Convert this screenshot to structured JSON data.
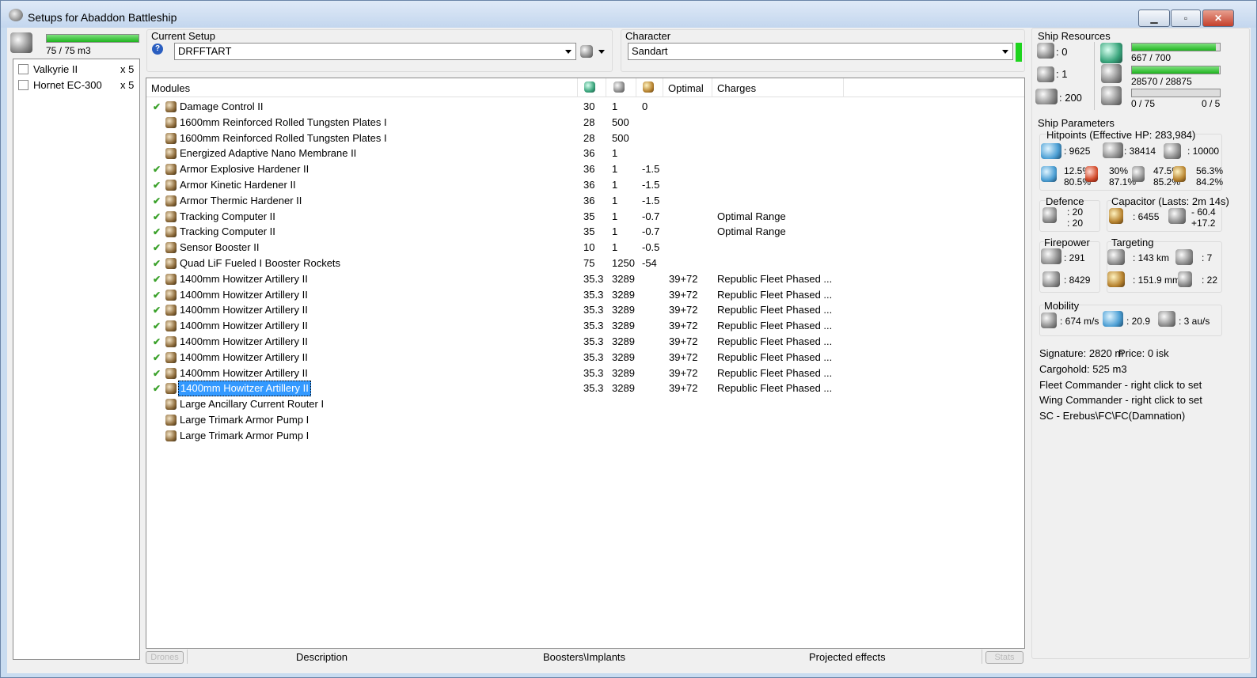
{
  "window": {
    "title": "Setups for Abaddon Battleship",
    "minimize": "▁",
    "maximize": "▫",
    "close": "✕"
  },
  "drones": {
    "bay_text": "75 / 75 m3",
    "bay_fill": 1.0,
    "items": [
      {
        "name": "Valkyrie II",
        "qty": "x 5"
      },
      {
        "name": "Hornet EC-300",
        "qty": "x 5"
      }
    ]
  },
  "setup": {
    "label": "Current Setup",
    "value": "DRFFTART",
    "help": "?"
  },
  "character": {
    "label": "Character",
    "value": "Sandart"
  },
  "modules": {
    "headers": {
      "name": "Modules",
      "optimal": "Optimal",
      "charges": "Charges"
    },
    "rows": [
      {
        "check": "✔",
        "name": "Damage Control II",
        "cpu": "30",
        "pg": "1",
        "cap": "0",
        "optimal": "",
        "charges": ""
      },
      {
        "check": "",
        "name": "1600mm Reinforced Rolled Tungsten Plates I",
        "cpu": "28",
        "pg": "500",
        "cap": "",
        "optimal": "",
        "charges": ""
      },
      {
        "check": "",
        "name": "1600mm Reinforced Rolled Tungsten Plates I",
        "cpu": "28",
        "pg": "500",
        "cap": "",
        "optimal": "",
        "charges": ""
      },
      {
        "check": "",
        "name": "Energized Adaptive Nano Membrane II",
        "cpu": "36",
        "pg": "1",
        "cap": "",
        "optimal": "",
        "charges": ""
      },
      {
        "check": "✔",
        "name": "Armor Explosive Hardener II",
        "cpu": "36",
        "pg": "1",
        "cap": "-1.5",
        "optimal": "",
        "charges": ""
      },
      {
        "check": "✔",
        "name": "Armor Kinetic Hardener II",
        "cpu": "36",
        "pg": "1",
        "cap": "-1.5",
        "optimal": "",
        "charges": ""
      },
      {
        "check": "✔",
        "name": "Armor Thermic Hardener II",
        "cpu": "36",
        "pg": "1",
        "cap": "-1.5",
        "optimal": "",
        "charges": ""
      },
      {
        "check": "✔",
        "name": "Tracking Computer II",
        "cpu": "35",
        "pg": "1",
        "cap": "-0.7",
        "optimal": "",
        "charges": "Optimal Range"
      },
      {
        "check": "✔",
        "name": "Tracking Computer II",
        "cpu": "35",
        "pg": "1",
        "cap": "-0.7",
        "optimal": "",
        "charges": "Optimal Range"
      },
      {
        "check": "✔",
        "name": "Sensor Booster II",
        "cpu": "10",
        "pg": "1",
        "cap": "-0.5",
        "optimal": "",
        "charges": ""
      },
      {
        "check": "✔",
        "name": "Quad LiF Fueled I Booster Rockets",
        "cpu": "75",
        "pg": "1250",
        "cap": "-54",
        "optimal": "",
        "charges": ""
      },
      {
        "check": "✔",
        "name": "1400mm Howitzer Artillery II",
        "cpu": "35.3",
        "pg": "3289",
        "cap": "",
        "optimal": "39+72",
        "charges": "Republic Fleet Phased ..."
      },
      {
        "check": "✔",
        "name": "1400mm Howitzer Artillery II",
        "cpu": "35.3",
        "pg": "3289",
        "cap": "",
        "optimal": "39+72",
        "charges": "Republic Fleet Phased ..."
      },
      {
        "check": "✔",
        "name": "1400mm Howitzer Artillery II",
        "cpu": "35.3",
        "pg": "3289",
        "cap": "",
        "optimal": "39+72",
        "charges": "Republic Fleet Phased ..."
      },
      {
        "check": "✔",
        "name": "1400mm Howitzer Artillery II",
        "cpu": "35.3",
        "pg": "3289",
        "cap": "",
        "optimal": "39+72",
        "charges": "Republic Fleet Phased ..."
      },
      {
        "check": "✔",
        "name": "1400mm Howitzer Artillery II",
        "cpu": "35.3",
        "pg": "3289",
        "cap": "",
        "optimal": "39+72",
        "charges": "Republic Fleet Phased ..."
      },
      {
        "check": "✔",
        "name": "1400mm Howitzer Artillery II",
        "cpu": "35.3",
        "pg": "3289",
        "cap": "",
        "optimal": "39+72",
        "charges": "Republic Fleet Phased ..."
      },
      {
        "check": "✔",
        "name": "1400mm Howitzer Artillery II",
        "cpu": "35.3",
        "pg": "3289",
        "cap": "",
        "optimal": "39+72",
        "charges": "Republic Fleet Phased ..."
      },
      {
        "check": "✔",
        "name": "1400mm Howitzer Artillery II",
        "cpu": "35.3",
        "pg": "3289",
        "cap": "",
        "optimal": "39+72",
        "charges": "Republic Fleet Phased ...",
        "selected": true
      },
      {
        "check": "",
        "name": "Large Ancillary Current Router I",
        "cpu": "",
        "pg": "",
        "cap": "",
        "optimal": "",
        "charges": ""
      },
      {
        "check": "",
        "name": "Large Trimark Armor Pump I",
        "cpu": "",
        "pg": "",
        "cap": "",
        "optimal": "",
        "charges": ""
      },
      {
        "check": "",
        "name": "Large Trimark Armor Pump I",
        "cpu": "",
        "pg": "",
        "cap": "",
        "optimal": "",
        "charges": ""
      }
    ]
  },
  "bottom": {
    "drones": "Drones",
    "description": "Description",
    "boosters": "Boosters\\Implants",
    "projected": "Projected effects",
    "stats": "Stats"
  },
  "resources": {
    "title": "Ship Resources",
    "hi": ": 0",
    "med": ": 1",
    "bay": ": 200",
    "cpu": "667 / 700",
    "cpu_fill": 0.953,
    "pg": "28570 / 28875",
    "pg_fill": 0.989,
    "cal": "0 / 75",
    "cal2": "0 / 5",
    "cal_fill": 0.0
  },
  "params": {
    "title": "Ship Parameters",
    "hp_title": "Hitpoints (Effective HP: 283,984)",
    "shield": ": 9625",
    "armor": ": 38414",
    "structure": ": 10000",
    "res": [
      [
        "12.5%",
        "80.5%"
      ],
      [
        "30%",
        "87.1%"
      ],
      [
        "47.5%",
        "85.2%"
      ],
      [
        "56.3%",
        "84.2%"
      ]
    ],
    "defence_title": "Defence",
    "def1": ": 20",
    "def2": ": 20",
    "cap_title": "Capacitor (Lasts: 2m 14s)",
    "cap_val": ": 6455",
    "cap_d1": "- 60.4",
    "cap_d2": "+17.2",
    "fire_title": "Firepower",
    "dps": ": 291",
    "volley": ": 8429",
    "tgt_title": "Targeting",
    "range": ": 143 km",
    "maxtgt": ": 7",
    "scan": ": 151.9 mm",
    "sensor": ": 22",
    "mob_title": "Mobility",
    "speed": ": 674 m/s",
    "agility": ": 20.9",
    "warp": ": 3 au/s",
    "signature": "Signature: 2820 m",
    "price": "Price: 0 isk",
    "cargo": "Cargohold: 525 m3",
    "fleet": "Fleet Commander - right click to set",
    "wing": "Wing Commander - right click to set",
    "sc": "SC - Erebus\\FC\\FC(Damnation)"
  }
}
